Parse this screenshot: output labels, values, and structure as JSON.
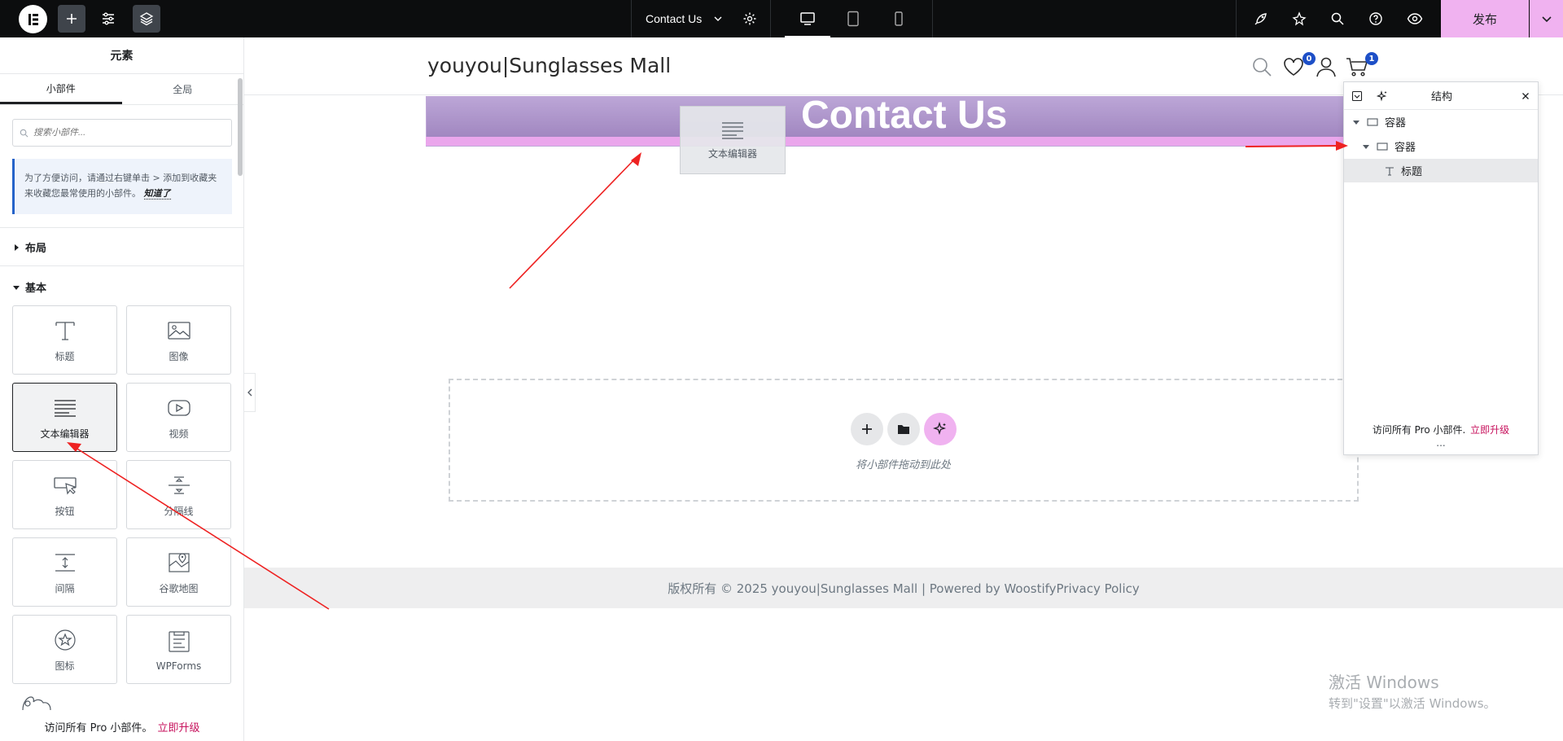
{
  "topbar": {
    "page_title": "Contact Us",
    "publish_label": "发布"
  },
  "left_panel": {
    "title": "元素",
    "tabs": [
      {
        "label": "小部件",
        "active": true
      },
      {
        "label": "全局",
        "active": false
      }
    ],
    "search_placeholder": "搜索小部件...",
    "tip_text": "为了方便访问，请通过右键单击 > 添加到收藏夹来收藏您最常使用的小部件。",
    "tip_link": "知道了",
    "sections": {
      "layout": "布局",
      "basic": "基本"
    },
    "widgets": [
      {
        "label": "标题",
        "icon": "heading-icon"
      },
      {
        "label": "图像",
        "icon": "image-icon"
      },
      {
        "label": "文本编辑器",
        "icon": "text-editor-icon",
        "selected": true
      },
      {
        "label": "视频",
        "icon": "video-icon"
      },
      {
        "label": "按钮",
        "icon": "button-icon"
      },
      {
        "label": "分隔线",
        "icon": "divider-icon"
      },
      {
        "label": "间隔",
        "icon": "spacer-icon"
      },
      {
        "label": "谷歌地图",
        "icon": "map-icon"
      },
      {
        "label": "图标",
        "icon": "star-icon"
      },
      {
        "label": "WPForms",
        "icon": "wpforms-icon"
      }
    ],
    "bottom_text": "访问所有 Pro 小部件。",
    "bottom_link": "立即升级"
  },
  "canvas": {
    "site_name": "youyou|Sunglasses Mall",
    "wishlist_count": "0",
    "cart_count": "1",
    "hero_title": "Contact Us",
    "drag_ghost_label": "文本编辑器",
    "drop_zone_text": "将小部件拖动到此处",
    "footer_text": "版权所有 © 2025 youyou|Sunglasses Mall | Powered by WoostifyPrivacy Policy"
  },
  "structure_panel": {
    "title": "结构",
    "items": [
      {
        "label": "容器",
        "level": 0
      },
      {
        "label": "容器",
        "level": 1
      },
      {
        "label": "标题",
        "level": 2,
        "active": true
      }
    ],
    "footer_text": "访问所有 Pro 小部件.",
    "footer_link": "立即升级",
    "dots": "..."
  },
  "windows_watermark": {
    "line1": "激活 Windows",
    "line2": "转到\"设置\"以激活 Windows。"
  },
  "colors": {
    "topbar": "#0c0d0e",
    "publish": "#f0b2f0",
    "accent_link": "#c7125d",
    "hero": "#a68dc6",
    "badge": "#1d4fc7",
    "annotation_arrow": "#ee2222"
  }
}
